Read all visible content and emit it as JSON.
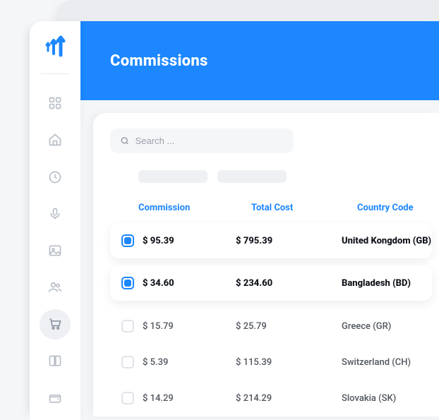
{
  "header": {
    "title": "Commissions"
  },
  "search": {
    "placeholder": "Search ..."
  },
  "columns": {
    "commission": "Commission",
    "totalCost": "Total Cost",
    "countryCode": "Country Code"
  },
  "rows": [
    {
      "selected": true,
      "commission": "$ 95.39",
      "totalCost": "$ 795.39",
      "country": "United Kongdom (GB)"
    },
    {
      "selected": true,
      "commission": "$ 34.60",
      "totalCost": "$ 234.60",
      "country": "Bangladesh (BD)"
    },
    {
      "selected": false,
      "commission": "$ 15.79",
      "totalCost": "$ 25.79",
      "country": "Greece (GR)"
    },
    {
      "selected": false,
      "commission": "$ 5.39",
      "totalCost": "$ 115.39",
      "country": "Switzerland (CH)"
    },
    {
      "selected": false,
      "commission": "$ 14.29",
      "totalCost": "$ 214.29",
      "country": "Slovakia (SK)"
    }
  ],
  "nav": {
    "items": [
      "dashboard",
      "home",
      "clock",
      "mic",
      "image",
      "users",
      "cart",
      "book",
      "wallet"
    ],
    "active": "cart"
  },
  "colors": {
    "accent": "#1c87ff"
  }
}
